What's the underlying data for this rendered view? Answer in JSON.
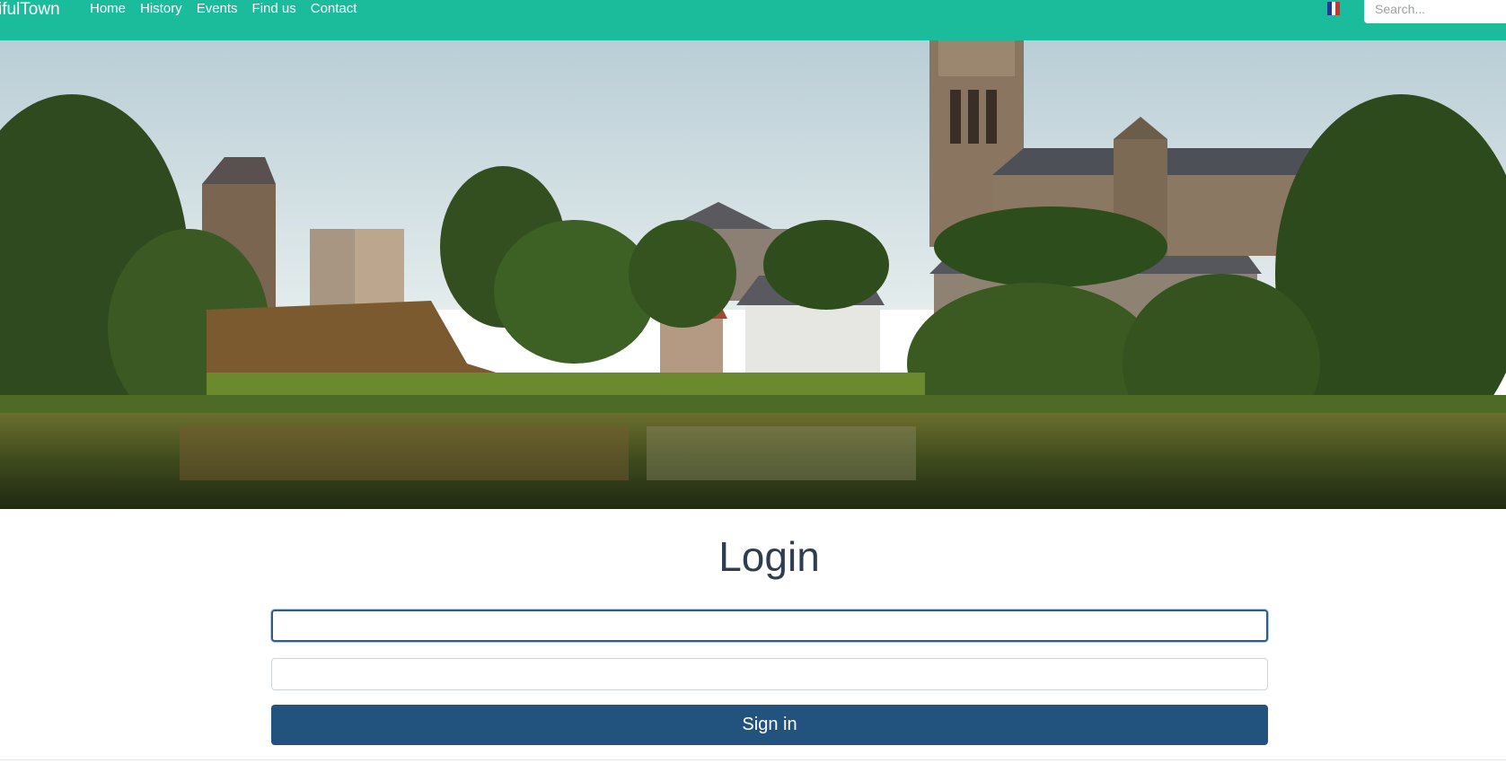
{
  "navbar": {
    "brand": "ifulTown",
    "links": [
      {
        "label": "Home"
      },
      {
        "label": "History"
      },
      {
        "label": "Events"
      },
      {
        "label": "Find us"
      },
      {
        "label": "Contact"
      }
    ],
    "language_flag": "french-flag-icon",
    "search": {
      "placeholder": "Search...",
      "value": ""
    },
    "background_color": "#1abc9c"
  },
  "hero": {
    "image": "town-landscape-with-church-and-lake"
  },
  "login": {
    "title": "Login",
    "username": {
      "value": "",
      "placeholder": ""
    },
    "password": {
      "value": "",
      "placeholder": ""
    },
    "submit_label": "Sign in",
    "submit_color": "#22527e"
  }
}
